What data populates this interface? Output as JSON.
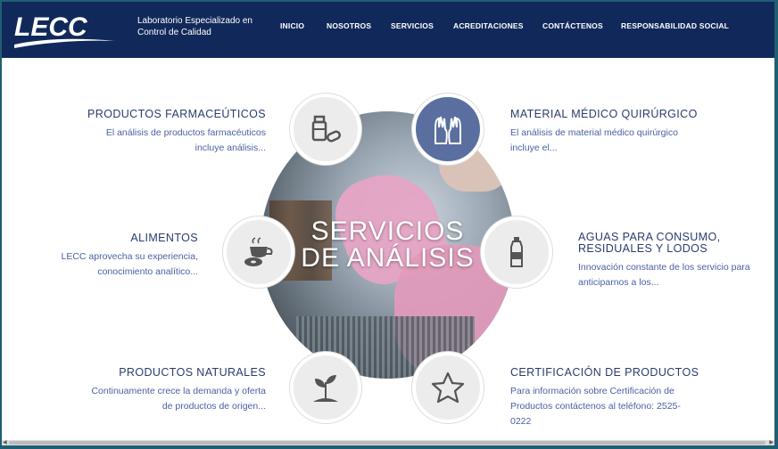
{
  "header": {
    "logo_text": "LECC",
    "tagline": "Laboratorio Especializado en Control de Calidad",
    "nav": [
      "INICIO",
      "NOSOTROS",
      "SERVICIOS",
      "ACREDITACIONES",
      "CONTÁCTENOS",
      "RESPONSABILIDAD SOCIAL"
    ]
  },
  "center": {
    "line1": "SERVICIOS",
    "line2": "DE ANÁLISIS"
  },
  "services": [
    {
      "title": "PRODUCTOS FARMACEÚTICOS",
      "desc": "El análisis de productos farmacéuticos incluye análisis...",
      "icon": "pills-icon"
    },
    {
      "title": "MATERIAL MÉDICO QUIRÚRGICO",
      "desc": "El análisis de material médico quirúrgico incluye el...",
      "icon": "gloves-icon"
    },
    {
      "title": "ALIMENTOS",
      "desc": "LECC aprovecha su experiencia, conocimiento analítico...",
      "icon": "coffee-donut-icon"
    },
    {
      "title": "AGUAS PARA CONSUMO, RESIDUALES Y LODOS",
      "desc": "Innovación constante de los servicio para anticiparnos a los...",
      "icon": "water-bottle-icon"
    },
    {
      "title": "PRODUCTOS NATURALES",
      "desc": "Continuamente crece la demanda y oferta de productos de origen...",
      "icon": "sprout-icon"
    },
    {
      "title": "CERTIFICACIÓN DE PRODUCTOS",
      "desc": "Para información sobre Certificación de Productos contáctenos al teléfono: 2525-0222",
      "icon": "star-icon"
    }
  ],
  "colors": {
    "header_bg": "#11295a",
    "accent": "#5a6f9f",
    "title": "#2b3b6e",
    "desc": "#4a5fa4"
  }
}
